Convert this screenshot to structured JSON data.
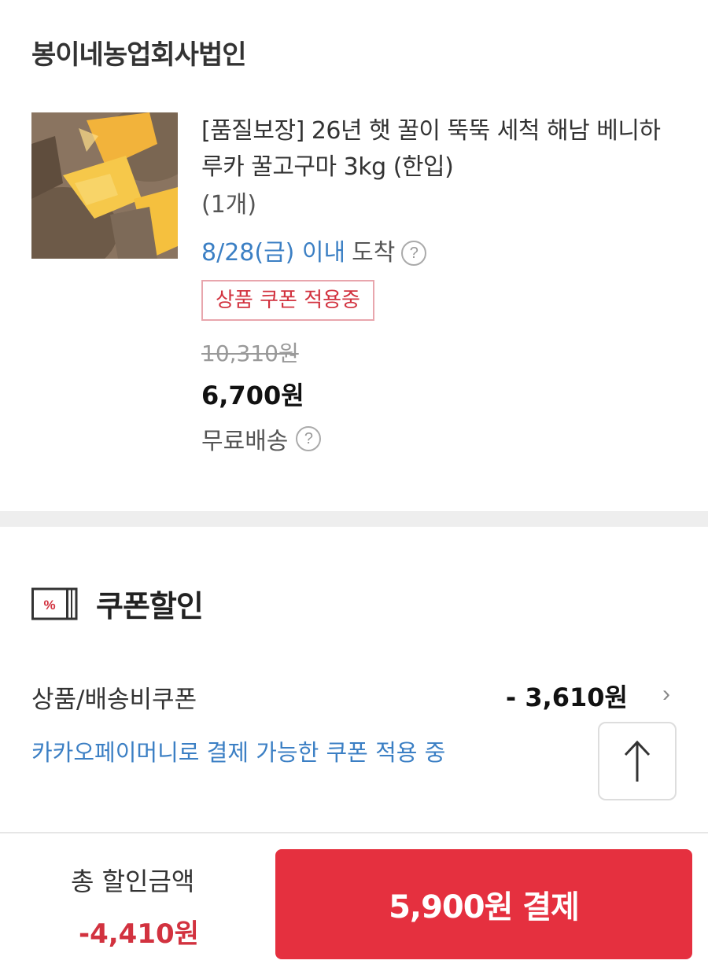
{
  "seller": {
    "name": "봉이네농업회사법인"
  },
  "product": {
    "title": "[품질보장] 26년 햇 꿀이 뚝뚝 세척 해남 베니하루카 꿀고구마 3kg (한입)",
    "quantity": "(1개)",
    "delivery_date": "8/28(금) 이내",
    "delivery_suffix": "도착",
    "coupon_badge": "상품 쿠폰 적용중",
    "original_price": "10,310원",
    "sale_price": "6,700원",
    "shipping": "무료배송",
    "image_icon": "sweet-potato-image"
  },
  "coupon_section": {
    "title": "쿠폰할인",
    "icon": "coupon-percent-icon",
    "row_label": "상품/배송비쿠폰",
    "row_amount": "- 3,610원",
    "note": "카카오페이머니로 결제 가능한 쿠폰 적용 중"
  },
  "bottom": {
    "total_label": "총 할인금액",
    "total_value": "-4,410원",
    "pay_button": "5,900원 결제"
  },
  "colors": {
    "accent_red": "#e5303f",
    "link_blue": "#3b7fc4",
    "badge_border": "#e8a6ad"
  },
  "icons": {
    "help": "?",
    "chevron": "›"
  }
}
